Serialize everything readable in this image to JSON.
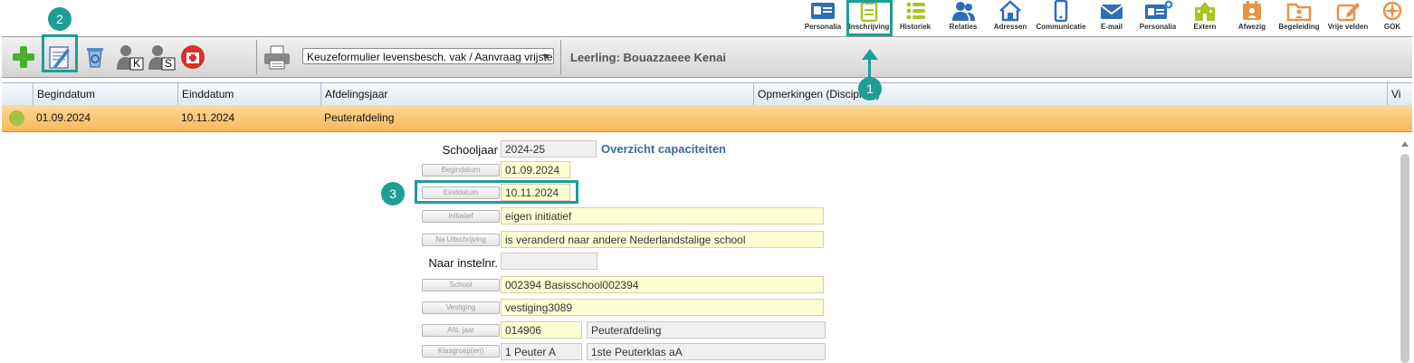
{
  "nav": {
    "items": [
      {
        "label": "Personalia",
        "color": "#2f6db5"
      },
      {
        "label": "Inschrijving",
        "color": "#a8c520"
      },
      {
        "label": "Historiek",
        "color": "#a8c520"
      },
      {
        "label": "Relaties",
        "color": "#2f6db5"
      },
      {
        "label": "Adressen",
        "color": "#2f6db5"
      },
      {
        "label": "Communicatie",
        "color": "#2f6db5"
      },
      {
        "label": "E-mail",
        "color": "#2f6db5"
      },
      {
        "label": "Personalia",
        "color": "#2f6db5"
      },
      {
        "label": "Extern",
        "color": "#a8c520"
      },
      {
        "label": "Afwezig",
        "color": "#e8924a"
      },
      {
        "label": "Begeleiding",
        "color": "#e8924a"
      },
      {
        "label": "Vrije velden",
        "color": "#e8924a"
      },
      {
        "label": "GOK",
        "color": "#e8924a"
      }
    ]
  },
  "toolbar": {
    "select_value": "Keuzeformulier levensbesch. vak / Aanvraag vrijstelling",
    "student_label": "Leerling: Bouazzaeee Kenai",
    "k_badge": "K",
    "s_badge": "S"
  },
  "grid": {
    "columns": [
      "Begindatum",
      "Einddatum",
      "Afdelingsjaar",
      "Opmerkingen (Discipline)",
      "Vi"
    ],
    "rows": [
      {
        "begindatum": "01.09.2024",
        "einddatum": "10.11.2024",
        "afdelingsjaar": "Peuterafdeling"
      }
    ]
  },
  "form": {
    "schooljaar_label": "Schooljaar",
    "schooljaar_value": "2024-25",
    "overview_link": "Overzicht capaciteiten",
    "begindatum_btn": "Begindatum",
    "begindatum_value": "01.09.2024",
    "einddatum_btn": "Einddatum",
    "einddatum_value": "10.11.2024",
    "initiatief_btn": "Initiatief",
    "initiatief_value": "eigen initiatief",
    "na_uitschrijving_btn": "Na Uitschrijving",
    "na_uitschrijving_value": "is veranderd naar andere Nederlandstalige school",
    "naar_instelnr_label": "Naar instelnr.",
    "naar_instelnr_value": "",
    "school_btn": "School",
    "school_value": "002394 Basisschool002394",
    "vestiging_btn": "Vestiging",
    "vestiging_value": "vestiging3089",
    "afd_jaar_btn": "Afd. jaar",
    "afd_jaar_code": "014906",
    "afd_jaar_name": "Peuterafdeling",
    "klasgroep_btn": "Klasgroep(en)",
    "klasgroep_code": "1 Peuter A",
    "klasgroep_name": "1ste Peuterklas aA"
  },
  "annotations": {
    "badge1": "1",
    "badge2": "2",
    "badge3": "3",
    "color": "#1f9e95"
  }
}
